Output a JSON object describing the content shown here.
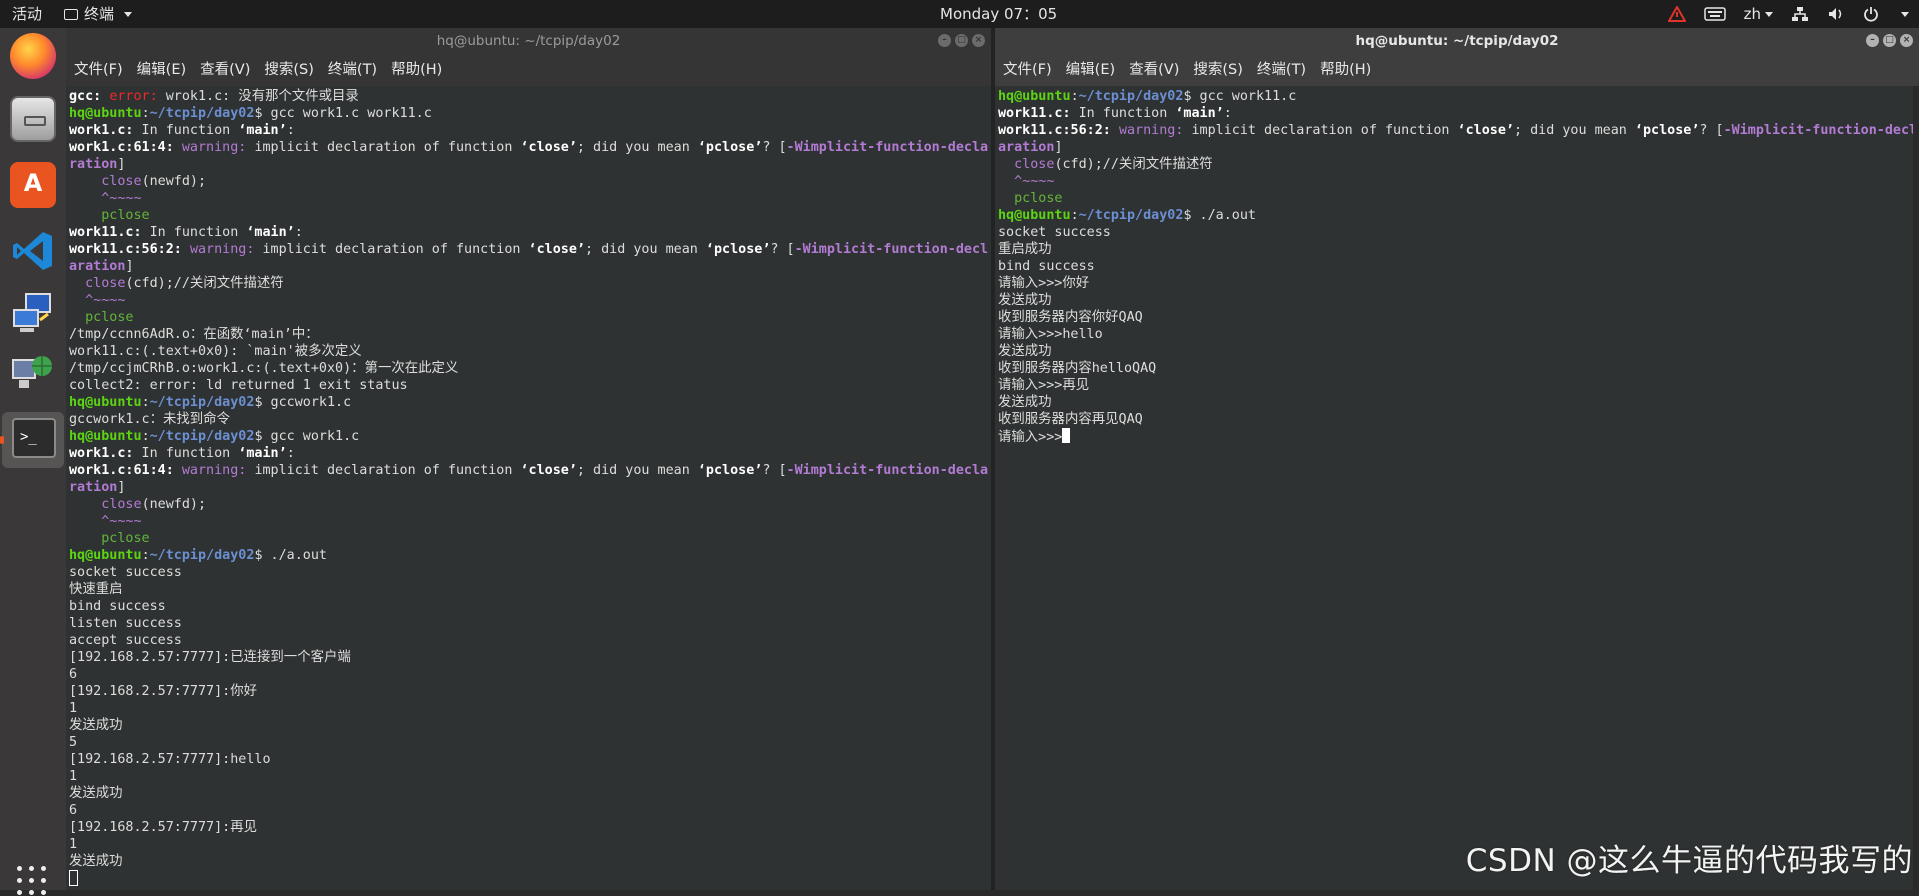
{
  "topbar": {
    "activities": "活动",
    "app_name": "终端",
    "clock": "Monday 07：05",
    "language": "zh"
  },
  "dock": {
    "items": [
      "firefox-icon",
      "files-icon",
      "software-icon",
      "vscode-icon",
      "remote-desktop-icon",
      "network-icon",
      "terminal-icon",
      "show-apps-icon"
    ]
  },
  "left_window": {
    "title": "hq@ubuntu: ~/tcpip/day02",
    "menus": [
      "文件(F)",
      "编辑(E)",
      "查看(V)",
      "搜索(S)",
      "终端(T)",
      "帮助(H)"
    ],
    "lines": [
      [
        [
          "tbw",
          "gcc: "
        ],
        [
          "tr",
          "error: "
        ],
        [
          "tw",
          "wrok1.c: 没有那个文件或目录"
        ]
      ],
      [
        [
          "tg",
          "hq@ubuntu"
        ],
        [
          "tw",
          ":"
        ],
        [
          "tb",
          "~/tcpip/day02"
        ],
        [
          "tw",
          "$ gcc work1.c work11.c"
        ]
      ],
      [
        [
          "tbw",
          "work1.c:"
        ],
        [
          "tw",
          " In function "
        ],
        [
          "tbw",
          "‘main’"
        ],
        [
          "tw",
          ":"
        ]
      ],
      [
        [
          "tbw",
          "work1.c:61:4: "
        ],
        [
          "tm",
          "warning: "
        ],
        [
          "tw",
          "implicit declaration of function "
        ],
        [
          "tbw",
          "‘close’"
        ],
        [
          "tw",
          "; did you mean "
        ],
        [
          "tbw",
          "‘pclose’"
        ],
        [
          "tw",
          "? ["
        ],
        [
          "tmb",
          "-Wimplicit-function-decla"
        ]
      ],
      [
        [
          "tmb",
          "ration"
        ],
        [
          "tw",
          "]"
        ]
      ],
      [
        [
          "tw",
          "    "
        ],
        [
          "tm",
          "close"
        ],
        [
          "tw",
          "(newfd);"
        ]
      ],
      [
        [
          "tw",
          "    "
        ],
        [
          "tm",
          "^~~~~"
        ]
      ],
      [
        [
          "tw",
          "    "
        ],
        [
          "tgreen",
          "pclose"
        ]
      ],
      [
        [
          "tbw",
          "work11.c:"
        ],
        [
          "tw",
          " In function "
        ],
        [
          "tbw",
          "‘main’"
        ],
        [
          "tw",
          ":"
        ]
      ],
      [
        [
          "tbw",
          "work11.c:56:2: "
        ],
        [
          "tm",
          "warning: "
        ],
        [
          "tw",
          "implicit declaration of function "
        ],
        [
          "tbw",
          "‘close’"
        ],
        [
          "tw",
          "; did you mean "
        ],
        [
          "tbw",
          "‘pclose’"
        ],
        [
          "tw",
          "? ["
        ],
        [
          "tmb",
          "-Wimplicit-function-decl"
        ]
      ],
      [
        [
          "tmb",
          "aration"
        ],
        [
          "tw",
          "]"
        ]
      ],
      [
        [
          "tw",
          "  "
        ],
        [
          "tm",
          "close"
        ],
        [
          "tw",
          "(cfd);//关闭文件描述符"
        ]
      ],
      [
        [
          "tw",
          "  "
        ],
        [
          "tm",
          "^~~~~"
        ]
      ],
      [
        [
          "tw",
          "  "
        ],
        [
          "tgreen",
          "pclose"
        ]
      ],
      [
        [
          "tw",
          "/tmp/ccnn6AdR.o：在函数‘main’中："
        ]
      ],
      [
        [
          "tw",
          "work11.c:(.text+0x0): `main'被多次定义"
        ]
      ],
      [
        [
          "tw",
          "/tmp/ccjmCRhB.o:work1.c:(.text+0x0)：第一次在此定义"
        ]
      ],
      [
        [
          "tw",
          "collect2: error: ld returned 1 exit status"
        ]
      ],
      [
        [
          "tg",
          "hq@ubuntu"
        ],
        [
          "tw",
          ":"
        ],
        [
          "tb",
          "~/tcpip/day02"
        ],
        [
          "tw",
          "$ gccwork1.c"
        ]
      ],
      [
        [
          "tw",
          "gccwork1.c：未找到命令"
        ]
      ],
      [
        [
          "tg",
          "hq@ubuntu"
        ],
        [
          "tw",
          ":"
        ],
        [
          "tb",
          "~/tcpip/day02"
        ],
        [
          "tw",
          "$ gcc work1.c"
        ]
      ],
      [
        [
          "tbw",
          "work1.c:"
        ],
        [
          "tw",
          " In function "
        ],
        [
          "tbw",
          "‘main’"
        ],
        [
          "tw",
          ":"
        ]
      ],
      [
        [
          "tbw",
          "work1.c:61:4: "
        ],
        [
          "tm",
          "warning: "
        ],
        [
          "tw",
          "implicit declaration of function "
        ],
        [
          "tbw",
          "‘close’"
        ],
        [
          "tw",
          "; did you mean "
        ],
        [
          "tbw",
          "‘pclose’"
        ],
        [
          "tw",
          "? ["
        ],
        [
          "tmb",
          "-Wimplicit-function-decla"
        ]
      ],
      [
        [
          "tmb",
          "ration"
        ],
        [
          "tw",
          "]"
        ]
      ],
      [
        [
          "tw",
          "    "
        ],
        [
          "tm",
          "close"
        ],
        [
          "tw",
          "(newfd);"
        ]
      ],
      [
        [
          "tw",
          "    "
        ],
        [
          "tm",
          "^~~~~"
        ]
      ],
      [
        [
          "tw",
          "    "
        ],
        [
          "tgreen",
          "pclose"
        ]
      ],
      [
        [
          "tg",
          "hq@ubuntu"
        ],
        [
          "tw",
          ":"
        ],
        [
          "tb",
          "~/tcpip/day02"
        ],
        [
          "tw",
          "$ ./a.out"
        ]
      ],
      [
        [
          "tw",
          "socket success"
        ]
      ],
      [
        [
          "tw",
          "快速重启"
        ]
      ],
      [
        [
          "tw",
          "bind success"
        ]
      ],
      [
        [
          "tw",
          "listen success"
        ]
      ],
      [
        [
          "tw",
          "accept success"
        ]
      ],
      [
        [
          "tw",
          "[192.168.2.57:7777]:已连接到一个客户端"
        ]
      ],
      [
        [
          "tw",
          "6"
        ]
      ],
      [
        [
          "tw",
          "[192.168.2.57:7777]:你好"
        ]
      ],
      [
        [
          "tw",
          "1"
        ]
      ],
      [
        [
          "tw",
          "发送成功"
        ]
      ],
      [
        [
          "tw",
          "5"
        ]
      ],
      [
        [
          "tw",
          "[192.168.2.57:7777]:hello"
        ]
      ],
      [
        [
          "tw",
          "1"
        ]
      ],
      [
        [
          "tw",
          "发送成功"
        ]
      ],
      [
        [
          "tw",
          "6"
        ]
      ],
      [
        [
          "tw",
          "[192.168.2.57:7777]:再见"
        ]
      ],
      [
        [
          "tw",
          "1"
        ]
      ],
      [
        [
          "tw",
          "发送成功"
        ]
      ],
      [
        [
          "cursor-hollow",
          ""
        ]
      ]
    ]
  },
  "right_window": {
    "title": "hq@ubuntu: ~/tcpip/day02",
    "menus": [
      "文件(F)",
      "编辑(E)",
      "查看(V)",
      "搜索(S)",
      "终端(T)",
      "帮助(H)"
    ],
    "lines": [
      [
        [
          "tg",
          "hq@ubuntu"
        ],
        [
          "tw",
          ":"
        ],
        [
          "tb",
          "~/tcpip/day02"
        ],
        [
          "tw",
          "$ gcc work11.c"
        ]
      ],
      [
        [
          "tbw",
          "work11.c:"
        ],
        [
          "tw",
          " In function "
        ],
        [
          "tbw",
          "‘main’"
        ],
        [
          "tw",
          ":"
        ]
      ],
      [
        [
          "tbw",
          "work11.c:56:2: "
        ],
        [
          "tm",
          "warning: "
        ],
        [
          "tw",
          "implicit declaration of function "
        ],
        [
          "tbw",
          "‘close’"
        ],
        [
          "tw",
          "; did you mean "
        ],
        [
          "tbw",
          "‘pclose’"
        ],
        [
          "tw",
          "? ["
        ],
        [
          "tmb",
          "-Wimplicit-function-decl"
        ]
      ],
      [
        [
          "tmb",
          "aration"
        ],
        [
          "tw",
          "]"
        ]
      ],
      [
        [
          "tw",
          "  "
        ],
        [
          "tm",
          "close"
        ],
        [
          "tw",
          "(cfd);//关闭文件描述符"
        ]
      ],
      [
        [
          "tw",
          "  "
        ],
        [
          "tm",
          "^~~~~"
        ]
      ],
      [
        [
          "tw",
          "  "
        ],
        [
          "tgreen",
          "pclose"
        ]
      ],
      [
        [
          "tg",
          "hq@ubuntu"
        ],
        [
          "tw",
          ":"
        ],
        [
          "tb",
          "~/tcpip/day02"
        ],
        [
          "tw",
          "$ ./a.out"
        ]
      ],
      [
        [
          "tw",
          "socket success"
        ]
      ],
      [
        [
          "tw",
          "重启成功"
        ]
      ],
      [
        [
          "tw",
          "bind success"
        ]
      ],
      [
        [
          "tw",
          "请输入>>>你好"
        ]
      ],
      [
        [
          "tw",
          "发送成功"
        ]
      ],
      [
        [
          "tw",
          "收到服务器内容你好QAQ"
        ]
      ],
      [
        [
          "tw",
          "请输入>>>hello"
        ]
      ],
      [
        [
          "tw",
          "发送成功"
        ]
      ],
      [
        [
          "tw",
          "收到服务器内容helloQAQ"
        ]
      ],
      [
        [
          "tw",
          "请输入>>>再见"
        ]
      ],
      [
        [
          "tw",
          "发送成功"
        ]
      ],
      [
        [
          "tw",
          "收到服务器内容再见QAQ"
        ]
      ],
      [
        [
          "tw",
          "请输入>>>"
        ],
        [
          "cursor",
          ""
        ]
      ]
    ]
  },
  "watermark": "CSDN @这么牛逼的代码我写的"
}
